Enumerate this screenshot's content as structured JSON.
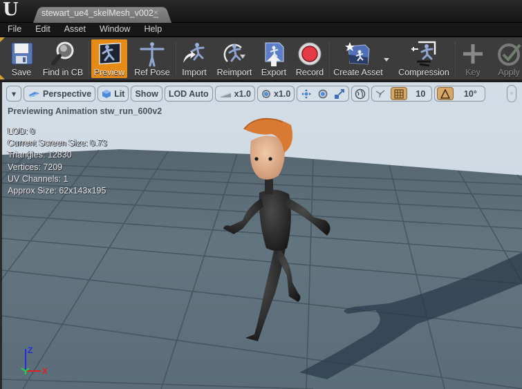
{
  "window": {
    "app_logo": "U",
    "document_tab": {
      "label": "stewart_ue4_skelMesh_v002_",
      "close_icon": "×"
    }
  },
  "menu": {
    "items": [
      {
        "label": "File"
      },
      {
        "label": "Edit"
      },
      {
        "label": "Asset"
      },
      {
        "label": "Window"
      },
      {
        "label": "Help"
      }
    ]
  },
  "toolbar": {
    "buttons": [
      {
        "id": "save",
        "label": "Save",
        "icon": "floppy-disk-icon",
        "active": false,
        "enabled": true
      },
      {
        "id": "find-in-cb",
        "label": "Find in CB",
        "icon": "magnifier-icon",
        "active": false,
        "enabled": true
      },
      {
        "id": "preview",
        "label": "Preview",
        "icon": "preview-running-figure-icon",
        "active": true,
        "enabled": true
      },
      {
        "id": "ref-pose",
        "label": "Ref Pose",
        "icon": "t-pose-figure-icon",
        "active": false,
        "enabled": true
      },
      {
        "id": "import",
        "label": "Import",
        "icon": "import-figure-icon",
        "active": false,
        "enabled": true
      },
      {
        "id": "reimport",
        "label": "Reimport",
        "icon": "reimport-figure-icon",
        "active": false,
        "enabled": true
      },
      {
        "id": "export",
        "label": "Export",
        "icon": "export-arrow-icon",
        "active": false,
        "enabled": true
      },
      {
        "id": "record",
        "label": "Record",
        "icon": "record-circle-icon",
        "active": false,
        "enabled": true
      },
      {
        "id": "create-asset",
        "label": "Create Asset",
        "icon": "create-asset-icon",
        "active": false,
        "enabled": true,
        "has_dropdown": true
      },
      {
        "id": "compression",
        "label": "Compression",
        "icon": "compression-icon",
        "active": false,
        "enabled": true
      },
      {
        "id": "key",
        "label": "Key",
        "icon": "plus-icon",
        "active": false,
        "enabled": false
      },
      {
        "id": "apply",
        "label": "Apply",
        "icon": "checkmark-icon",
        "active": false,
        "enabled": false
      }
    ],
    "accent_color": "#e58a12"
  },
  "viewport": {
    "toolbar": {
      "options_dropdown": "▾",
      "view_mode": "Perspective",
      "lighting": "Lit",
      "show": "Show",
      "lod": "LOD Auto",
      "playback_speed": "x1.0",
      "camera_speed": "x1.0",
      "grid_snap_value": "10",
      "rotation_snap_value": "10°",
      "grid_snap_enabled": true,
      "rotation_snap_enabled": true
    },
    "preview_title": "Previewing Animation stw_run_600v2",
    "stats": [
      {
        "label": "LOD",
        "value": "0"
      },
      {
        "label": "Current Screen Size",
        "value": "0.73"
      },
      {
        "label": "Triangles",
        "value": "12830"
      },
      {
        "label": "Vertices",
        "value": "7209"
      },
      {
        "label": "UV Channels",
        "value": "1"
      },
      {
        "label": "Approx Size",
        "value": "62x143x195"
      }
    ],
    "stat_lines": [
      "LOD: 0",
      "Current Screen Size: 0.73",
      "Triangles: 12830",
      "Vertices: 7209",
      "UV Channels: 1",
      "Approx Size: 62x143x195"
    ],
    "axis": {
      "z": "Z",
      "x": "X",
      "y": "Y"
    },
    "colors": {
      "sky": "#d0dae3",
      "floor": "#5f717d",
      "grid_line": "#3f4e58"
    }
  }
}
